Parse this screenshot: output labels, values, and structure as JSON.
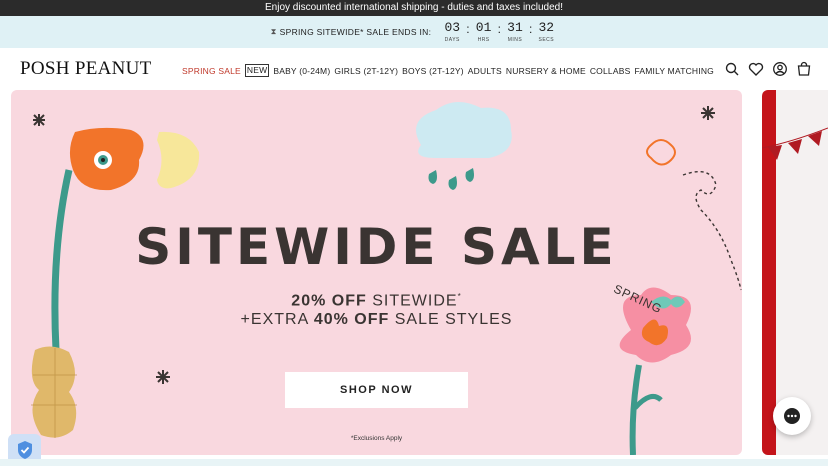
{
  "topbar": {
    "text": "Enjoy discounted international shipping - duties and taxes included!"
  },
  "countdown": {
    "icon": "hourglass-icon",
    "label": "SPRING SITEWIDE* SALE ENDS IN:",
    "days": "03",
    "hours": "01",
    "mins": "31",
    "secs": "32",
    "days_cap": "DAYS",
    "hours_cap": "HRS",
    "mins_cap": "MINS",
    "secs_cap": "SECS"
  },
  "nav": {
    "logo": "POSH PEANUT",
    "items": [
      {
        "label": "SPRING SALE"
      },
      {
        "label": "NEW"
      },
      {
        "label": "BABY (0-24M)"
      },
      {
        "label": "GIRLS (2T-12Y)"
      },
      {
        "label": "BOYS (2T-12Y)"
      },
      {
        "label": "ADULTS"
      },
      {
        "label": "NURSERY & HOME"
      },
      {
        "label": "COLLABS"
      },
      {
        "label": "FAMILY MATCHING"
      }
    ],
    "icons": [
      "search-icon",
      "heart-icon",
      "account-icon",
      "bag-icon"
    ]
  },
  "hero": {
    "spring": "SPRING",
    "title": "SITEWIDE SALE",
    "line1_bold": "20% OFF",
    "line1_rest": "SITEWIDE",
    "line1_mark": "*",
    "line2_pre": "+EXTRA",
    "line2_bold": "40% OFF",
    "line2_rest": "SALE STYLES",
    "button": "SHOP NOW",
    "note": "*Exclusions Apply"
  },
  "colors": {
    "hero_bg": "#f9d8df",
    "sale_red": "#c0392b",
    "countdown_bg": "#dff1f5"
  }
}
